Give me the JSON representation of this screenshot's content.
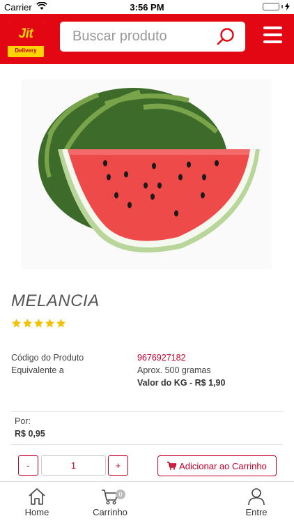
{
  "status_bar": {
    "carrier": "Carrier",
    "time": "3:56 PM"
  },
  "header": {
    "logo_text": "Jit",
    "logo_subtext": "Delivery",
    "search_placeholder": "Buscar produto",
    "search_icon": "search-icon",
    "menu_icon": "hamburger-menu-icon",
    "brand_color": "#e30613",
    "logo_yellow": "#ffd400"
  },
  "product": {
    "image": "watermelon-photo",
    "name": "MELANCIA",
    "rating": 5,
    "rating_max": 5,
    "code_label": "Código do Produto",
    "code_value": "9676927182",
    "equivalent_label": "Equivalente a",
    "approx_text": "Aprox. 500 gramas",
    "kg_price_text": "Valor do KG - R$ 1,90",
    "price_label": "Por:",
    "price": "R$ 0,95",
    "accent_color": "#c4002b",
    "star_color": "#f2c100"
  },
  "cart_controls": {
    "minus_label": "-",
    "quantity": "1",
    "plus_label": "+",
    "add_to_cart_label": "Adicionar ao Carrinho",
    "add_to_cart_icon": "shopping-cart-icon"
  },
  "tab_bar": {
    "home_label": "Home",
    "cart_label": "Carrinho",
    "cart_count": "0",
    "login_label": "Entre"
  }
}
